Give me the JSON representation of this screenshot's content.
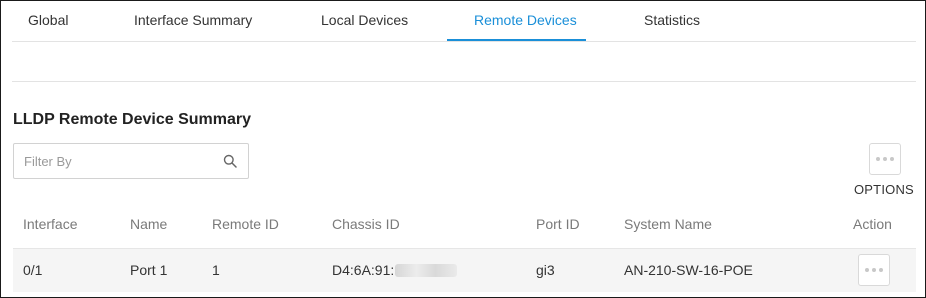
{
  "tabs": [
    {
      "label": "Global"
    },
    {
      "label": "Interface Summary"
    },
    {
      "label": "Local Devices"
    },
    {
      "label": "Remote Devices",
      "active": true
    },
    {
      "label": "Statistics"
    }
  ],
  "section": {
    "title": "LLDP Remote Device Summary"
  },
  "filter": {
    "placeholder": "Filter By",
    "value": "",
    "icon": "search-icon"
  },
  "options": {
    "label": "OPTIONS",
    "icon": "more-horizontal-icon"
  },
  "table": {
    "columns": [
      "Interface",
      "Name",
      "Remote ID",
      "Chassis ID",
      "Port ID",
      "System Name",
      "Action"
    ],
    "rows": [
      {
        "interface": "0/1",
        "name": "Port 1",
        "remote_id": "1",
        "chassis_id": "D4:6A:91:",
        "port_id": "gi3",
        "system_name": "AN-210-SW-16-POE",
        "action_icon": "more-horizontal-icon"
      }
    ]
  },
  "colors": {
    "accent": "#1a8fd8",
    "row_bg": "#f5f5f5"
  }
}
